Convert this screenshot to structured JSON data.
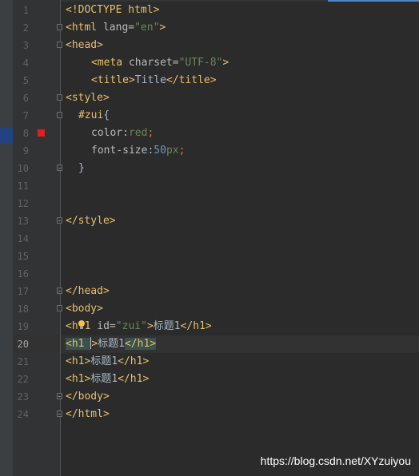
{
  "editor": {
    "current_line": 20,
    "colors": {
      "background": "#2b2b2b",
      "gutter": "#313335",
      "tag": "#e8bf6a",
      "string": "#6a8759",
      "number": "#6897bb",
      "keyword": "#cc7832",
      "breakpoint": "#e41e1e"
    }
  },
  "lines": [
    {
      "num": "1",
      "t": [
        "<!DOCTYPE html>"
      ]
    },
    {
      "num": "2",
      "t": [
        "<html ",
        "lang",
        "=",
        "\"en\"",
        ">"
      ]
    },
    {
      "num": "3",
      "t": [
        "<head>"
      ]
    },
    {
      "num": "4",
      "t": [
        "<meta ",
        "charset",
        "=",
        "\"UTF-8\"",
        ">"
      ]
    },
    {
      "num": "5",
      "t": [
        "<title>",
        "Title",
        "</title>"
      ]
    },
    {
      "num": "6",
      "t": [
        "<style>"
      ]
    },
    {
      "num": "7",
      "t": [
        "#zui",
        "{"
      ]
    },
    {
      "num": "8",
      "t": [
        "color",
        ":",
        "red",
        ";"
      ]
    },
    {
      "num": "9",
      "t": [
        "font-size",
        ":",
        "50",
        "px",
        ";"
      ]
    },
    {
      "num": "10",
      "t": [
        "}"
      ]
    },
    {
      "num": "11",
      "t": []
    },
    {
      "num": "12",
      "t": []
    },
    {
      "num": "13",
      "t": [
        "</style>"
      ]
    },
    {
      "num": "14",
      "t": []
    },
    {
      "num": "15",
      "t": []
    },
    {
      "num": "16",
      "t": []
    },
    {
      "num": "17",
      "t": [
        "</head>"
      ]
    },
    {
      "num": "18",
      "t": [
        "<body>"
      ]
    },
    {
      "num": "19",
      "t": [
        "<h",
        "1",
        " id",
        "=",
        "\"zui\"",
        ">",
        "标题1",
        "</h1>"
      ]
    },
    {
      "num": "20",
      "t": [
        "<h1 ",
        ">",
        "标题1",
        "</h1>"
      ]
    },
    {
      "num": "21",
      "t": [
        "<h1>",
        "标题1",
        "</h1>"
      ]
    },
    {
      "num": "22",
      "t": [
        "<h1>",
        "标题1",
        "</h1>"
      ]
    },
    {
      "num": "23",
      "t": [
        "</body>"
      ]
    },
    {
      "num": "24",
      "t": [
        "</html>"
      ]
    }
  ],
  "watermark": "https://blog.csdn.net/XYzuiyou"
}
